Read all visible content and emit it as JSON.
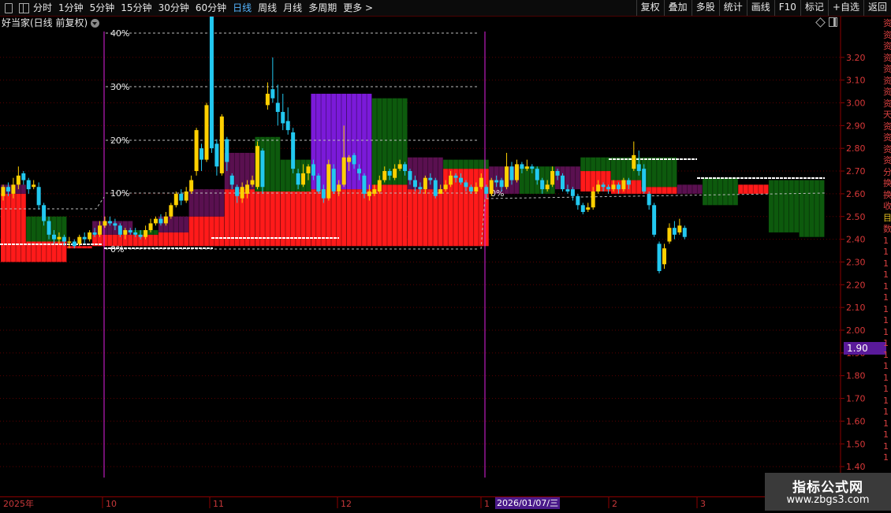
{
  "toolbar": {
    "timeframes": [
      "分时",
      "1分钟",
      "5分钟",
      "15分钟",
      "30分钟",
      "60分钟",
      "日线",
      "周线",
      "月线",
      "多周期",
      "更多 >"
    ],
    "active": "日线",
    "right_buttons": [
      "复权",
      "叠加",
      "多股",
      "统计",
      "画线",
      "F10",
      "标记",
      "+自选",
      "返回"
    ]
  },
  "chart_title": "好当家(日线 前复权)",
  "current_price_tag": "1.90",
  "cursor_date": "2026/01/07/三",
  "watermark": {
    "line1": "指标公式网",
    "line2": "www.zbgs3.com"
  },
  "right_strip_chars": [
    "资",
    "资",
    "资",
    "资",
    "资",
    "资",
    "资",
    "资",
    "天",
    "资",
    "资",
    "资",
    "资",
    "分",
    "换",
    "换",
    "收",
    "目",
    "数",
    "1",
    "1",
    "1",
    "1",
    "1",
    "1",
    "1",
    "1",
    "1",
    "1",
    "1",
    "1",
    "1",
    "1",
    "1",
    "1",
    "1",
    "1",
    "1",
    "1"
  ],
  "chart_data": {
    "type": "candlestick",
    "y_axis": {
      "min": 1.4,
      "max": 3.3,
      "ticks": [
        "3.20",
        "3.10",
        "3.00",
        "2.90",
        "2.80",
        "2.70",
        "2.60",
        "2.50",
        "2.40",
        "2.30",
        "2.20",
        "2.10",
        "2.00",
        "1.90",
        "1.80",
        "1.70",
        "1.60",
        "1.50",
        "1.40"
      ]
    },
    "x_date_labels": [
      "2025年",
      "10",
      "11",
      "12",
      "1",
      "2",
      "3"
    ],
    "percent_labels": [
      "40%",
      "30%",
      "20%",
      "10%",
      "0%",
      "0%"
    ],
    "candles": [
      [
        2.59,
        2.63,
        2.64,
        2.57
      ],
      [
        2.63,
        2.61,
        2.65,
        2.59
      ],
      [
        2.6,
        2.64,
        2.67,
        2.58
      ],
      [
        2.64,
        2.68,
        2.72,
        2.62
      ],
      [
        2.69,
        2.66,
        2.7,
        2.64
      ],
      [
        2.66,
        2.62,
        2.67,
        2.6
      ],
      [
        2.63,
        2.64,
        2.66,
        2.62
      ],
      [
        2.63,
        2.55,
        2.65,
        2.53
      ],
      [
        2.55,
        2.48,
        2.56,
        2.46
      ],
      [
        2.48,
        2.42,
        2.5,
        2.4
      ],
      [
        2.42,
        2.4,
        2.44,
        2.38
      ],
      [
        2.4,
        2.41,
        2.43,
        2.38
      ],
      [
        2.41,
        2.39,
        2.42,
        2.37
      ],
      [
        2.39,
        2.39,
        2.41,
        2.36
      ],
      [
        2.39,
        2.37,
        2.4,
        2.36
      ],
      [
        2.38,
        2.41,
        2.42,
        2.37
      ],
      [
        2.41,
        2.4,
        2.43,
        2.38
      ],
      [
        2.4,
        2.43,
        2.44,
        2.39
      ],
      [
        2.43,
        2.42,
        2.45,
        2.41
      ],
      [
        2.42,
        2.46,
        2.48,
        2.41
      ],
      [
        2.46,
        2.48,
        2.5,
        2.45
      ],
      [
        2.48,
        2.47,
        2.5,
        2.46
      ],
      [
        2.47,
        2.46,
        2.49,
        2.44
      ],
      [
        2.46,
        2.42,
        2.47,
        2.41
      ],
      [
        2.42,
        2.44,
        2.45,
        2.4
      ],
      [
        2.44,
        2.43,
        2.45,
        2.42
      ],
      [
        2.43,
        2.42,
        2.45,
        2.41
      ],
      [
        2.42,
        2.41,
        2.44,
        2.4
      ],
      [
        2.41,
        2.44,
        2.46,
        2.4
      ],
      [
        2.44,
        2.47,
        2.49,
        2.43
      ],
      [
        2.47,
        2.49,
        2.5,
        2.46
      ],
      [
        2.49,
        2.47,
        2.51,
        2.46
      ],
      [
        2.47,
        2.5,
        2.52,
        2.46
      ],
      [
        2.5,
        2.55,
        2.56,
        2.49
      ],
      [
        2.55,
        2.6,
        2.61,
        2.54
      ],
      [
        2.6,
        2.57,
        2.62,
        2.55
      ],
      [
        2.57,
        2.61,
        2.63,
        2.56
      ],
      [
        2.61,
        2.66,
        2.68,
        2.6
      ],
      [
        2.7,
        2.88,
        2.89,
        2.68
      ],
      [
        2.8,
        2.75,
        2.82,
        2.7
      ],
      [
        2.75,
        2.99,
        3.0,
        2.74
      ],
      [
        3.38,
        2.8,
        3.4,
        2.78
      ],
      [
        2.82,
        2.72,
        2.84,
        2.68
      ],
      [
        2.69,
        2.94,
        2.95,
        2.68
      ],
      [
        2.84,
        2.74,
        2.85,
        2.7
      ],
      [
        2.68,
        2.64,
        2.69,
        2.62
      ],
      [
        2.63,
        2.59,
        2.64,
        2.56
      ],
      [
        2.58,
        2.63,
        2.65,
        2.56
      ],
      [
        2.6,
        2.64,
        2.66,
        2.58
      ],
      [
        2.64,
        2.66,
        2.68,
        2.63
      ],
      [
        2.63,
        2.81,
        2.83,
        2.62
      ],
      [
        2.79,
        2.63,
        2.8,
        2.6
      ],
      [
        2.99,
        3.04,
        3.09,
        2.97
      ],
      [
        3.06,
        3.02,
        3.2,
        3.0
      ],
      [
        3.0,
        2.96,
        3.08,
        2.9
      ],
      [
        2.96,
        2.91,
        3.04,
        2.88
      ],
      [
        2.92,
        2.88,
        2.98,
        2.86
      ],
      [
        2.87,
        2.71,
        2.89,
        2.69
      ],
      [
        2.69,
        2.64,
        2.71,
        2.62
      ],
      [
        2.64,
        2.69,
        2.73,
        2.63
      ],
      [
        2.69,
        2.72,
        2.73,
        2.66
      ],
      [
        2.73,
        2.68,
        2.75,
        2.66
      ],
      [
        2.68,
        2.61,
        2.69,
        2.6
      ],
      [
        2.62,
        2.58,
        2.64,
        2.56
      ],
      [
        2.58,
        2.73,
        2.75,
        2.57
      ],
      [
        2.71,
        2.61,
        2.73,
        2.6
      ],
      [
        2.61,
        2.64,
        2.66,
        2.59
      ],
      [
        2.64,
        2.76,
        2.9,
        2.63
      ],
      [
        2.74,
        2.76,
        2.77,
        2.7
      ],
      [
        2.77,
        2.73,
        2.78,
        2.71
      ],
      [
        2.71,
        2.69,
        2.73,
        2.66
      ],
      [
        2.68,
        2.6,
        2.69,
        2.58
      ],
      [
        2.59,
        2.61,
        2.64,
        2.57
      ],
      [
        2.6,
        2.62,
        2.64,
        2.59
      ],
      [
        2.61,
        2.66,
        2.68,
        2.6
      ],
      [
        2.66,
        2.7,
        2.72,
        2.65
      ],
      [
        2.7,
        2.68,
        2.71,
        2.66
      ],
      [
        2.67,
        2.71,
        2.73,
        2.66
      ],
      [
        2.71,
        2.73,
        2.75,
        2.7
      ],
      [
        2.73,
        2.7,
        2.74,
        2.68
      ],
      [
        2.7,
        2.66,
        2.71,
        2.64
      ],
      [
        2.66,
        2.63,
        2.68,
        2.61
      ],
      [
        2.63,
        2.62,
        2.65,
        2.6
      ],
      [
        2.62,
        2.67,
        2.68,
        2.6
      ],
      [
        2.67,
        2.66,
        2.69,
        2.64
      ],
      [
        2.66,
        2.59,
        2.67,
        2.58
      ],
      [
        2.6,
        2.62,
        2.64,
        2.6
      ],
      [
        2.62,
        2.64,
        2.66,
        2.61
      ],
      [
        2.64,
        2.68,
        2.7,
        2.63
      ],
      [
        2.68,
        2.67,
        2.69,
        2.65
      ],
      [
        2.67,
        2.65,
        2.69,
        2.64
      ],
      [
        2.65,
        2.63,
        2.66,
        2.61
      ],
      [
        2.63,
        2.61,
        2.64,
        2.6
      ],
      [
        2.61,
        2.63,
        2.65,
        2.6
      ],
      [
        2.63,
        2.67,
        2.69,
        2.62
      ],
      [
        2.63,
        2.6,
        2.64,
        2.58
      ],
      [
        2.6,
        2.66,
        2.67,
        2.59
      ],
      [
        2.66,
        2.65,
        2.68,
        2.63
      ],
      [
        2.66,
        2.63,
        2.67,
        2.61
      ],
      [
        2.63,
        2.72,
        2.78,
        2.62
      ],
      [
        2.72,
        2.66,
        2.74,
        2.64
      ],
      [
        2.66,
        2.73,
        2.75,
        2.65
      ],
      [
        2.73,
        2.71,
        2.74,
        2.69
      ],
      [
        2.71,
        2.72,
        2.75,
        2.7
      ],
      [
        2.72,
        2.71,
        2.73,
        2.69
      ],
      [
        2.71,
        2.66,
        2.72,
        2.64
      ],
      [
        2.66,
        2.62,
        2.67,
        2.6
      ],
      [
        2.62,
        2.64,
        2.66,
        2.61
      ],
      [
        2.64,
        2.7,
        2.72,
        2.63
      ],
      [
        2.7,
        2.68,
        2.71,
        2.66
      ],
      [
        2.68,
        2.62,
        2.69,
        2.61
      ],
      [
        2.62,
        2.61,
        2.64,
        2.6
      ],
      [
        2.62,
        2.59,
        2.63,
        2.57
      ],
      [
        2.59,
        2.55,
        2.6,
        2.53
      ],
      [
        2.55,
        2.52,
        2.56,
        2.51
      ],
      [
        2.53,
        2.54,
        2.56,
        2.52
      ],
      [
        2.54,
        2.61,
        2.63,
        2.53
      ],
      [
        2.61,
        2.64,
        2.66,
        2.6
      ],
      [
        2.64,
        2.63,
        2.65,
        2.61
      ],
      [
        2.63,
        2.62,
        2.64,
        2.6
      ],
      [
        2.62,
        2.64,
        2.66,
        2.61
      ],
      [
        2.64,
        2.62,
        2.65,
        2.6
      ],
      [
        2.62,
        2.66,
        2.67,
        2.61
      ],
      [
        2.66,
        2.64,
        2.67,
        2.62
      ],
      [
        2.71,
        2.77,
        2.83,
        2.7
      ],
      [
        2.73,
        2.7,
        2.79,
        2.68
      ],
      [
        2.71,
        2.61,
        2.73,
        2.6
      ],
      [
        2.6,
        2.55,
        2.61,
        2.53
      ],
      [
        2.55,
        2.42,
        2.56,
        2.41
      ],
      [
        2.38,
        2.26,
        2.39,
        2.25
      ],
      [
        2.29,
        2.36,
        2.38,
        2.27
      ],
      [
        2.39,
        2.45,
        2.47,
        2.38
      ],
      [
        2.45,
        2.42,
        2.48,
        2.4
      ],
      [
        2.43,
        2.46,
        2.49,
        2.42
      ],
      [
        2.45,
        2.41,
        2.46,
        2.4
      ]
    ],
    "zones": [
      {
        "from": 0,
        "to": 4,
        "a": 2.3,
        "b": 2.6,
        "color": "#ff1a1a"
      },
      {
        "from": 0,
        "to": 4,
        "a": 2.6,
        "b": 2.64,
        "color": "#5a1050"
      },
      {
        "from": 5,
        "to": 12,
        "a": 2.3,
        "b": 2.39,
        "color": "#ff1a1a"
      },
      {
        "from": 5,
        "to": 12,
        "a": 2.39,
        "b": 2.5,
        "color": "#0d5a0d"
      },
      {
        "from": 13,
        "to": 17,
        "a": 2.36,
        "b": 2.37,
        "color": "#ff1a1a"
      },
      {
        "from": 18,
        "to": 25,
        "a": 2.37,
        "b": 2.42,
        "color": "#ff1a1a"
      },
      {
        "from": 18,
        "to": 25,
        "a": 2.42,
        "b": 2.48,
        "color": "#5a1050"
      },
      {
        "from": 26,
        "to": 30,
        "a": 2.37,
        "b": 2.42,
        "color": "#ff1a1a"
      },
      {
        "from": 26,
        "to": 30,
        "a": 2.42,
        "b": 2.44,
        "color": "#0d5a0d"
      },
      {
        "from": 31,
        "to": 36,
        "a": 2.37,
        "b": 2.43,
        "color": "#ff1a1a"
      },
      {
        "from": 31,
        "to": 36,
        "a": 2.43,
        "b": 2.5,
        "color": "#5a1050"
      },
      {
        "from": 37,
        "to": 43,
        "a": 2.37,
        "b": 2.5,
        "color": "#ff1a1a"
      },
      {
        "from": 37,
        "to": 43,
        "a": 2.5,
        "b": 2.62,
        "color": "#5a1050"
      },
      {
        "from": 44,
        "to": 49,
        "a": 2.37,
        "b": 2.62,
        "color": "#ff1a1a"
      },
      {
        "from": 44,
        "to": 49,
        "a": 2.62,
        "b": 2.78,
        "color": "#5a1050"
      },
      {
        "from": 50,
        "to": 54,
        "a": 2.37,
        "b": 2.61,
        "color": "#ff1a1a"
      },
      {
        "from": 50,
        "to": 54,
        "a": 2.61,
        "b": 2.85,
        "color": "#0d5a0d"
      },
      {
        "from": 55,
        "to": 60,
        "a": 2.37,
        "b": 2.61,
        "color": "#ff1a1a"
      },
      {
        "from": 55,
        "to": 60,
        "a": 2.61,
        "b": 2.75,
        "color": "#0d5a0d"
      },
      {
        "from": 61,
        "to": 67,
        "a": 2.37,
        "b": 2.62,
        "color": "#ff1a1a"
      },
      {
        "from": 61,
        "to": 67,
        "a": 2.62,
        "b": 3.04,
        "color": "#7b1ad9"
      },
      {
        "from": 68,
        "to": 72,
        "a": 2.37,
        "b": 2.62,
        "color": "#ff1a1a"
      },
      {
        "from": 68,
        "to": 72,
        "a": 2.62,
        "b": 3.04,
        "color": "#7b1ad9"
      },
      {
        "from": 73,
        "to": 79,
        "a": 2.37,
        "b": 2.64,
        "color": "#ff1a1a"
      },
      {
        "from": 73,
        "to": 79,
        "a": 2.64,
        "b": 3.02,
        "color": "#0d5a0d"
      },
      {
        "from": 80,
        "to": 86,
        "a": 2.37,
        "b": 2.62,
        "color": "#ff1a1a"
      },
      {
        "from": 80,
        "to": 86,
        "a": 2.62,
        "b": 2.76,
        "color": "#5a1050"
      },
      {
        "from": 87,
        "to": 95,
        "a": 2.37,
        "b": 2.71,
        "color": "#ff1a1a"
      },
      {
        "from": 87,
        "to": 95,
        "a": 2.71,
        "b": 2.75,
        "color": "#0d5a0d"
      },
      {
        "from": 96,
        "to": 101,
        "a": 2.6,
        "b": 2.72,
        "color": "#5a1050"
      },
      {
        "from": 102,
        "to": 108,
        "a": 2.6,
        "b": 2.72,
        "color": "#0d5a0d"
      },
      {
        "from": 109,
        "to": 113,
        "a": 2.62,
        "b": 2.72,
        "color": "#5a1050"
      },
      {
        "from": 114,
        "to": 119,
        "a": 2.61,
        "b": 2.7,
        "color": "#ff1a1a"
      },
      {
        "from": 114,
        "to": 119,
        "a": 2.7,
        "b": 2.76,
        "color": "#0d5a0d"
      },
      {
        "from": 120,
        "to": 125,
        "a": 2.6,
        "b": 2.66,
        "color": "#ff1a1a"
      },
      {
        "from": 120,
        "to": 125,
        "a": 2.66,
        "b": 2.76,
        "color": "#0d5a0d"
      },
      {
        "from": 126,
        "to": 132,
        "a": 2.6,
        "b": 2.63,
        "color": "#ff1a1a"
      },
      {
        "from": 126,
        "to": 132,
        "a": 2.63,
        "b": 2.76,
        "color": "#0d5a0d"
      },
      {
        "from": 133,
        "to": 137,
        "a": 2.6,
        "b": 2.64,
        "color": "#5a1050"
      },
      {
        "from": 138,
        "to": 144,
        "a": 2.55,
        "b": 2.67,
        "color": "#0d5a0d"
      },
      {
        "from": 145,
        "to": 150,
        "a": 2.6,
        "b": 2.64,
        "color": "#ff1a1a"
      },
      {
        "from": 151,
        "to": 156,
        "a": 2.43,
        "b": 2.66,
        "color": "#0d5a0d"
      },
      {
        "from": 157,
        "to": 161,
        "a": 2.41,
        "b": 2.66,
        "color": "#0d5a0d"
      }
    ]
  }
}
